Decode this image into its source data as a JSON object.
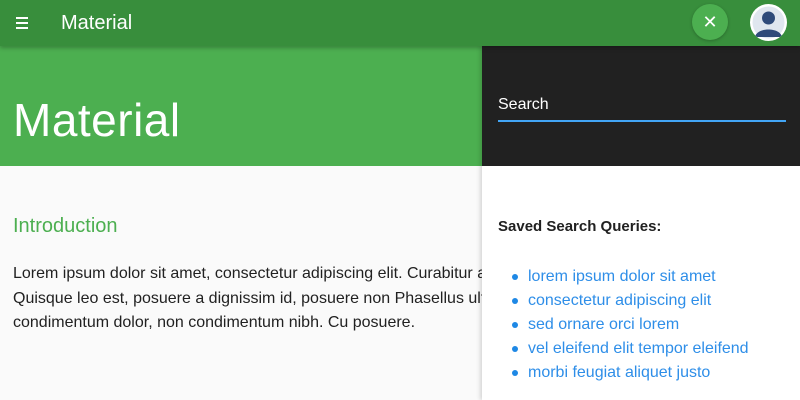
{
  "appbar": {
    "title": "Material",
    "menu_icon": "menu-icon",
    "close_icon": "close-icon",
    "close_glyph": "✕",
    "avatar_icon": "user-avatar-icon"
  },
  "hero": {
    "title": "Material"
  },
  "content": {
    "section_title": "Introduction",
    "paragraph": "Lorem ipsum dolor sit amet, consectetur adipiscing elit. Curabitur at vel purus. Quisque leo est, posuere a dignissim id, posuere non Phasellus ultrices condimentum dolor, non condimentum nibh. Cu posuere."
  },
  "drawer": {
    "search": {
      "placeholder": "Search",
      "value": ""
    },
    "saved_heading": "Saved Search Queries:",
    "saved_queries": [
      "lorem ipsum dolor sit amet",
      "consectetur adipiscing elit",
      "sed ornare orci lorem",
      "vel eleifend elit tempor eleifend",
      "morbi feugiat aliquet justo"
    ]
  },
  "colors": {
    "appbar": "#388e3c",
    "primary": "#4caf50",
    "drawer_head": "#212121",
    "link": "#2e8ee8",
    "search_underline": "#42a5f5"
  }
}
